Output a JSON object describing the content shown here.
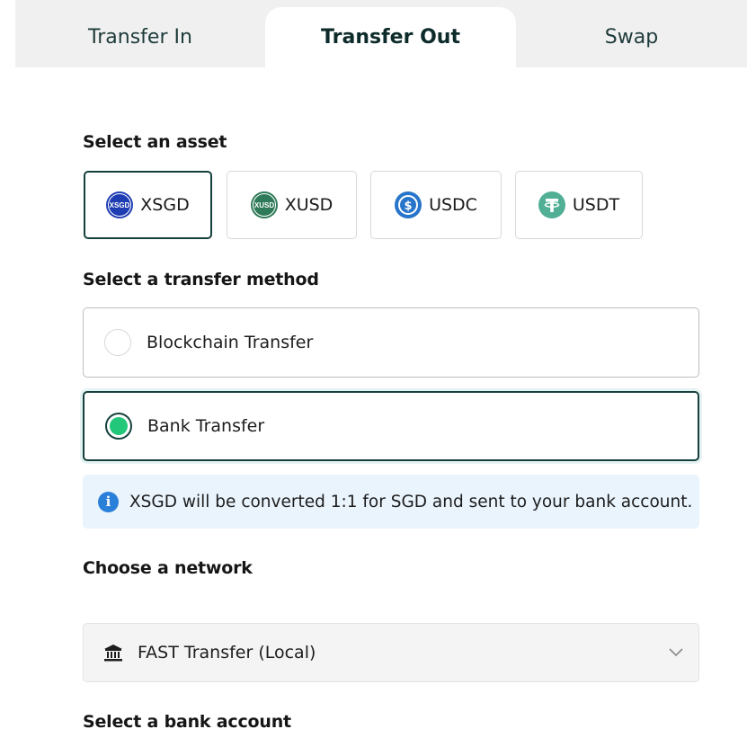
{
  "tabs": [
    {
      "label": "Transfer In",
      "active": false
    },
    {
      "label": "Transfer Out",
      "active": true
    },
    {
      "label": "Swap",
      "active": false
    }
  ],
  "asset_section": {
    "label": "Select an asset",
    "assets": [
      {
        "label": "XSGD",
        "icon": "xsgd-icon",
        "icon_text": "XSGD",
        "color": "#1f3db3",
        "selected": true
      },
      {
        "label": "XUSD",
        "icon": "xusd-icon",
        "icon_text": "XUSD",
        "color": "#2f7a58",
        "selected": false
      },
      {
        "label": "USDC",
        "icon": "usdc-icon",
        "icon_text": "$",
        "color": "#2775ca",
        "selected": false
      },
      {
        "label": "USDT",
        "icon": "usdt-icon",
        "icon_text": "₮",
        "color": "#50af95",
        "selected": false
      }
    ]
  },
  "method_section": {
    "label": "Select a transfer method",
    "options": [
      {
        "label": "Blockchain Transfer",
        "selected": false
      },
      {
        "label": "Bank Transfer",
        "selected": true
      }
    ]
  },
  "info": {
    "text": "XSGD will be converted 1:1 for SGD and sent to your bank account.",
    "icon": "info-icon"
  },
  "network_section": {
    "label": "Choose a network",
    "selected_value": "FAST Transfer (Local)",
    "icon": "bank-icon"
  },
  "bank_section": {
    "label": "Select a bank account"
  },
  "colors": {
    "accent_dark": "#16403d",
    "radio_fill": "#22c77a",
    "info_bg": "#eaf4fd",
    "info_icon": "#2a7fd9"
  }
}
